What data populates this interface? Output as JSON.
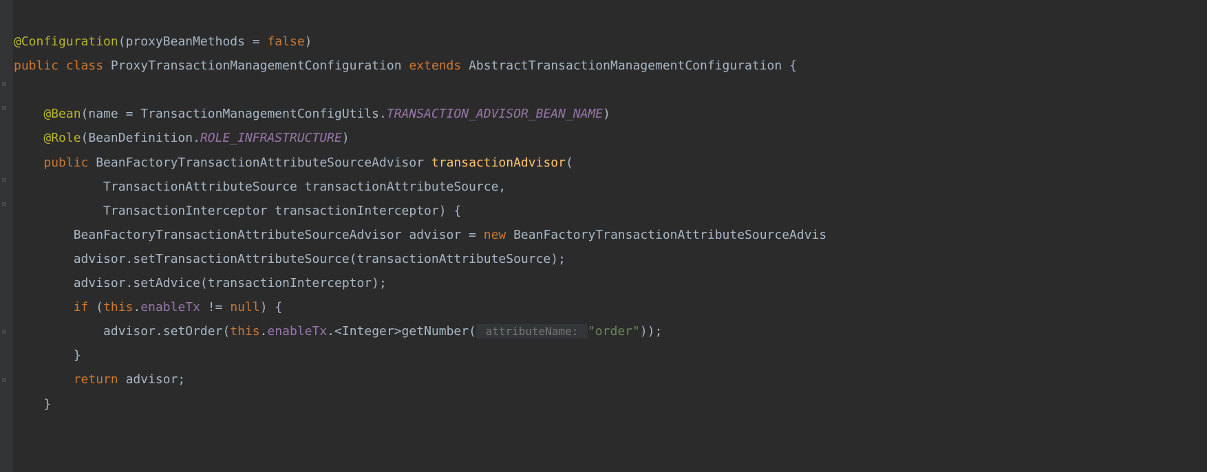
{
  "code": {
    "line1_annotation": "@Configuration",
    "line1_paren_open": "(",
    "line1_param": "proxyBeanMethods = ",
    "line1_value": "false",
    "line1_paren_close": ")",
    "line2_kw1": "public class ",
    "line2_class": "ProxyTransactionManagementConfiguration ",
    "line2_kw2": "extends ",
    "line2_super": "AbstractTransactionManagementConfiguration {",
    "line3": "",
    "line4_annotation": "@Bean",
    "line4_rest1": "(name = TransactionManagementConfigUtils.",
    "line4_const": "TRANSACTION_ADVISOR_BEAN_NAME",
    "line4_rest2": ")",
    "line5_annotation": "@Role",
    "line5_rest1": "(BeanDefinition.",
    "line5_const": "ROLE_INFRASTRUCTURE",
    "line5_rest2": ")",
    "line6_kw": "public ",
    "line6_type": "BeanFactoryTransactionAttributeSourceAdvisor ",
    "line6_method": "transactionAdvisor",
    "line6_paren": "(",
    "line7": "TransactionAttributeSource transactionAttributeSource,",
    "line8": "TransactionInterceptor transactionInterceptor) {",
    "line9_a": "BeanFactoryTransactionAttributeSourceAdvisor advisor = ",
    "line9_kw": "new ",
    "line9_b": "BeanFactoryTransactionAttributeSourceAdvis",
    "line10": "advisor.setTransactionAttributeSource(transactionAttributeSource);",
    "line11": "advisor.setAdvice(transactionInterceptor);",
    "line12_kw1": "if ",
    "line12_a": "(",
    "line12_kw2": "this",
    "line12_b": ".",
    "line12_field": "enableTx",
    "line12_c": " != ",
    "line12_kw3": "null",
    "line12_d": ") {",
    "line13_a": "advisor.setOrder(",
    "line13_kw": "this",
    "line13_b": ".",
    "line13_field": "enableTx",
    "line13_c": ".<Integer>getNumber(",
    "line13_hint": " attributeName: ",
    "line13_str": "\"order\"",
    "line13_d": "));",
    "line14": "}",
    "line15_kw": "return ",
    "line15_a": "advisor;",
    "line16": "}"
  }
}
